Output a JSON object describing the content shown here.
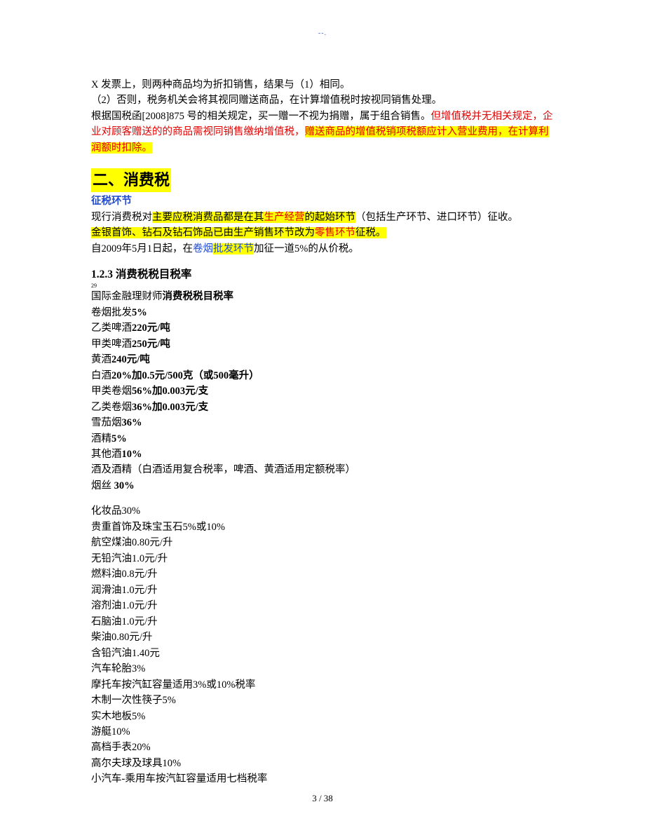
{
  "header_mark": "--.",
  "p1_line1": "X 发票上，则两种商品均为折扣销售，结果与（1）相同。",
  "p1_line2": "（2）否则，税务机关会将其视同赠送商品，在计算增值税时按视同销售处理。",
  "p1_line3a": "        根据国税函[2008]875 号的相关规定，买一赠一不视为捐赠，属于组合销售。",
  "p1_line3b": "但增值税并无相关规定，企业对顾客赠送的的商品需视同销售缴纳增值税，",
  "p1_line3c": "赠送商品的增值税销项税额应计入营业费用，在计算利润额时扣除。",
  "section2": "二、消费税",
  "sub_blue": "征税环节",
  "tax_line1_a": "现行消费税对",
  "tax_line1_b": "主要应税消费品都是在其",
  "tax_line1_c": "生产经营",
  "tax_line1_d": "的起始环节",
  "tax_line1_e": "（包括生产环节、进口环节）征收。",
  "tax_line2_a": "金银首饰、钻石及钻石饰品已由生产销售环节改为",
  "tax_line2_b": "零售环节",
  "tax_line2_c": "征税。",
  "tax_line3_a": "自2009年5月1日起，在",
  "tax_line3_b": "卷烟",
  "tax_line3_c": "批发环节",
  "tax_line3_d": "加征一道5%的从价税。",
  "h123": "1.2.3  消费税税目税率",
  "tiny_mark": "29",
  "rate_intro": "国际金融理财师消费税税目税率",
  "rates_bold": [
    "卷烟批发5%",
    "乙类啤酒220元/吨",
    "甲类啤酒250元/吨",
    "黄酒240元/吨",
    "白酒20%加0.5元/500克（或500毫升）",
    "甲类卷烟56%加0.003元/支",
    "乙类卷烟36%加0.003元/支",
    "雪茄烟36%",
    "酒精5%",
    "其他酒10%"
  ],
  "rate_compound": "酒及酒精（白酒适用复合税率，啤酒、黄酒适用定额税率）",
  "rate_yansi_a": "烟丝 ",
  "rate_yansi_b": "30%",
  "rates_plain": [
    "化妆品30%",
    "贵重首饰及珠宝玉石5%或10%",
    "航空煤油0.80元/升",
    "无铅汽油1.0元/升",
    "燃料油0.8元/升",
    "润滑油1.0元/升",
    "溶剂油1.0元/升",
    "石脑油1.0元/升",
    "柴油0.80元/升",
    "含铅汽油1.40元",
    "汽车轮胎3%",
    "摩托车按汽缸容量适用3%或10%税率",
    "木制一次性筷子5%",
    "实木地板5%",
    "游艇10%",
    "高档手表20%",
    "高尔夫球及球具10%",
    "小汽车-乘用车按汽缸容量适用七档税率"
  ],
  "page_num": "3  / 38"
}
